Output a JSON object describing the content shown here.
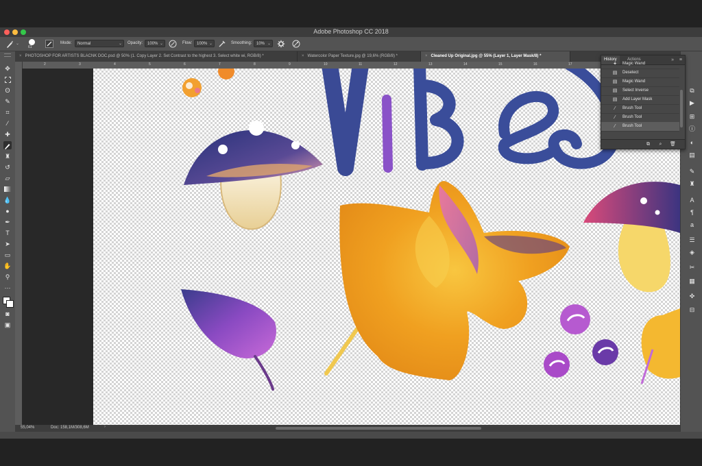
{
  "app": {
    "title": "Adobe Photoshop CC 2018",
    "traffic_colors": [
      "#fc605b",
      "#fdbc40",
      "#34c84a"
    ]
  },
  "options": {
    "brush_size": "61",
    "mode_label": "Mode:",
    "mode_value": "Normal",
    "opacity_label": "Opacity:",
    "opacity_value": "100%",
    "flow_label": "Flow:",
    "flow_value": "100%",
    "smoothing_label": "Smoothing:",
    "smoothing_value": "10%"
  },
  "tabs": [
    {
      "label": "PHOTOSHOP FOR ARTISTS BLACNK DOC.psd @ 50% (1. Copy Layer 2. Set Contrast to the highest 3. Select white wi, RGB/8) *",
      "active": false
    },
    {
      "label": "Watercolor Paper Texture.jpg @ 19,6% (RGB/8) *",
      "active": false
    },
    {
      "label": "Cleaned Up Original.jpg @ 55% (Layer 1, Layer Mask/8) *",
      "active": true
    }
  ],
  "ruler": {
    "numbers": [
      "2",
      "3",
      "4",
      "5",
      "6",
      "7",
      "8",
      "9",
      "10",
      "11",
      "12",
      "13",
      "14",
      "15",
      "16",
      "17",
      "18",
      "19",
      "20"
    ]
  },
  "canvas": {
    "lettering": "VIBES"
  },
  "history": {
    "tabs": [
      "History",
      "Actions"
    ],
    "items": [
      {
        "label": "Magic Wand",
        "icon": "magic-wand-icon"
      },
      {
        "label": "Deselect",
        "icon": "history-state-icon"
      },
      {
        "label": "Magic Wand",
        "icon": "history-state-icon"
      },
      {
        "label": "Select Inverse",
        "icon": "history-state-icon"
      },
      {
        "label": "Add Layer Mask",
        "icon": "history-state-icon"
      },
      {
        "label": "Brush Tool",
        "icon": "brush-icon"
      },
      {
        "label": "Brush Tool",
        "icon": "brush-icon"
      },
      {
        "label": "Brush Tool",
        "icon": "brush-icon"
      }
    ],
    "current_index": 7
  },
  "status": {
    "zoom": "55,04%",
    "doc": "Doc: 158,1M/308,6M"
  }
}
